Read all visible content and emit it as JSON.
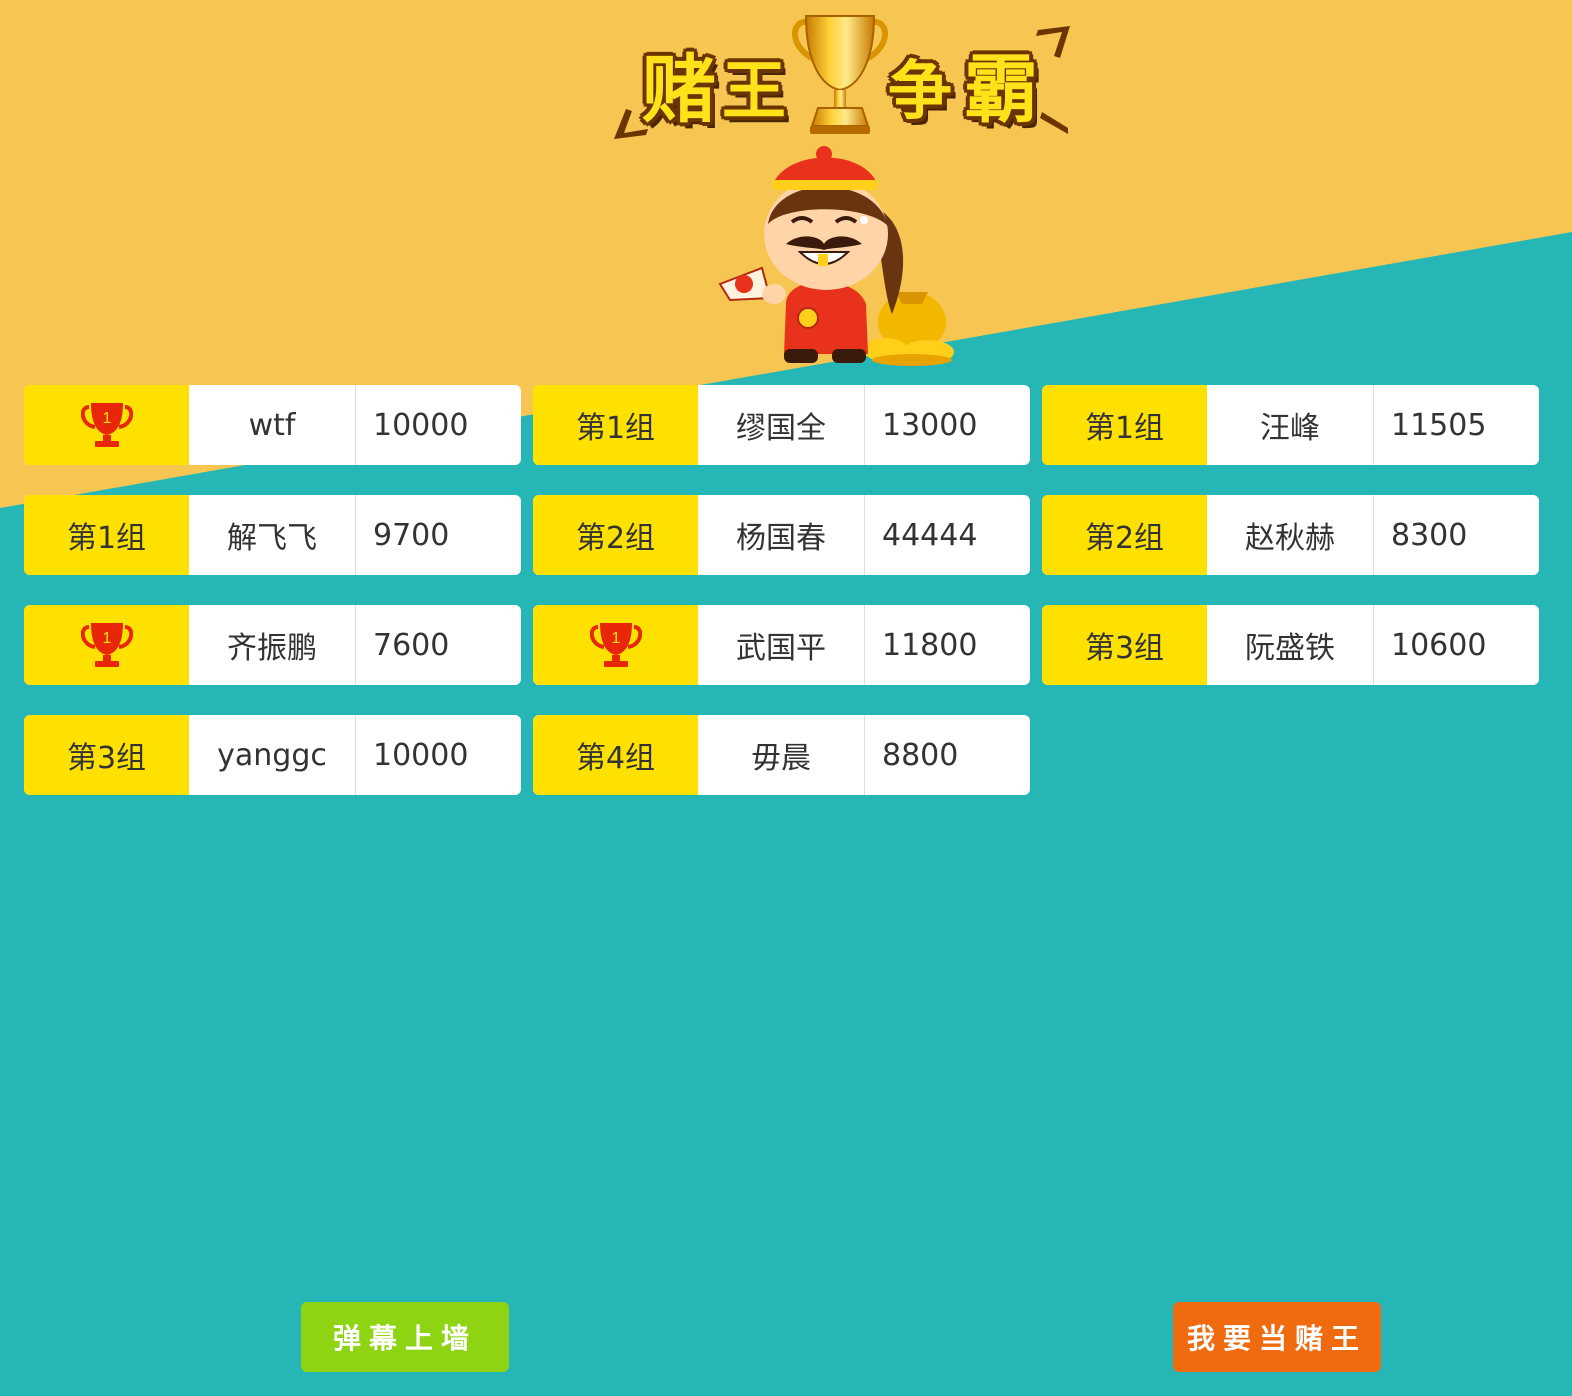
{
  "colors": {
    "background_teal": "#26b6b6",
    "background_yellow": "#f7c652",
    "group_yellow": "#ffe100",
    "button_green": "#8fd413",
    "button_orange": "#f06a0f",
    "trophy_red": "#e8260a"
  },
  "header": {
    "title_chars": [
      "赌",
      "王",
      "争",
      "霸"
    ],
    "trophy_icon": "gold-trophy-icon",
    "mascot": "god-of-wealth-mascot"
  },
  "entries": [
    {
      "group": "",
      "badge": "trophy-rank-1-icon",
      "badge_number": "1",
      "name": "wtf",
      "score": "10000"
    },
    {
      "group": "第1组",
      "name": "缪国全",
      "score": "13000"
    },
    {
      "group": "第1组",
      "name": "汪峰",
      "score": "11505"
    },
    {
      "group": "第1组",
      "name": "解飞飞",
      "score": "9700"
    },
    {
      "group": "第2组",
      "name": "杨国春",
      "score": "44444"
    },
    {
      "group": "第2组",
      "name": "赵秋赫",
      "score": "8300"
    },
    {
      "group": "",
      "badge": "trophy-rank-1-icon",
      "badge_number": "1",
      "name": "齐振鹏",
      "score": "7600"
    },
    {
      "group": "",
      "badge": "trophy-rank-1-icon",
      "badge_number": "1",
      "name": "武国平",
      "score": "11800"
    },
    {
      "group": "第3组",
      "name": "阮盛铁",
      "score": "10600"
    },
    {
      "group": "第3组",
      "name": "yanggc",
      "score": "10000"
    },
    {
      "group": "第4组",
      "name": "毋晨",
      "score": "8800"
    }
  ],
  "buttons": {
    "danmu_label": "弹幕上墙",
    "king_label": "我要当赌王"
  }
}
